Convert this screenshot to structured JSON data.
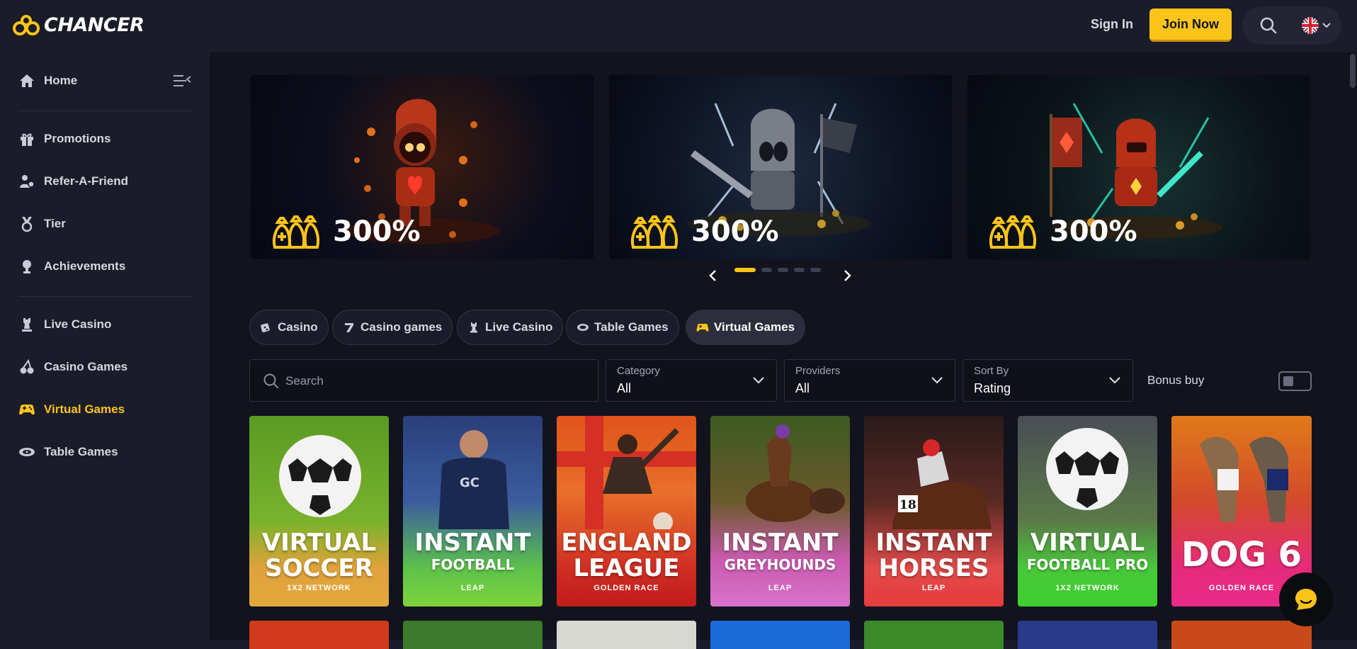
{
  "brand": {
    "name": "CHANCER",
    "accent": "#fcc419"
  },
  "header": {
    "sign_in": "Sign In",
    "join_now": "Join Now"
  },
  "sidebar": {
    "home": "Home",
    "items": [
      {
        "label": "Promotions",
        "icon": "gift-icon"
      },
      {
        "label": "Refer-A-Friend",
        "icon": "refer-friend-icon"
      },
      {
        "label": "Tier",
        "icon": "medal-icon"
      },
      {
        "label": "Achievements",
        "icon": "trophy-icon"
      }
    ],
    "categories": [
      {
        "label": "Live Casino",
        "icon": "chess-piece-icon"
      },
      {
        "label": "Casino Games",
        "icon": "cherries-icon"
      },
      {
        "label": "Virtual Games",
        "icon": "gamepad-icon",
        "active": true
      },
      {
        "label": "Table Games",
        "icon": "chips-icon"
      }
    ]
  },
  "banners": [
    {
      "text": "300%",
      "theme": "fire-knight"
    },
    {
      "text": "300%",
      "theme": "dark-knight"
    },
    {
      "text": "300%",
      "theme": "red-knight"
    }
  ],
  "carousel": {
    "slides": 5,
    "active": 1
  },
  "tabs": [
    {
      "label": "Casino"
    },
    {
      "label": "Casino games"
    },
    {
      "label": "Live Casino"
    },
    {
      "label": "Table Games"
    },
    {
      "label": "Virtual Games",
      "active": true
    }
  ],
  "filters": {
    "search_placeholder": "Search",
    "category": {
      "label": "Category",
      "value": "All"
    },
    "providers": {
      "label": "Providers",
      "value": "All"
    },
    "sort": {
      "label": "Sort By",
      "value": "Rating"
    },
    "bonus_buy": "Bonus buy"
  },
  "games": [
    {
      "line1": "VIRTUAL",
      "line2": "SOCCER",
      "provider": "1X2 NETWORK"
    },
    {
      "line1": "INSTANT",
      "line2": "FOOTBALL",
      "provider": "LEAP"
    },
    {
      "line1": "ENGLAND",
      "line2": "LEAGUE",
      "provider": "GOLDEN RACE"
    },
    {
      "line1": "INSTANT",
      "line2": "GREYHOUNDS",
      "provider": "LEAP"
    },
    {
      "line1": "INSTANT",
      "line2": "HORSES",
      "provider": "LEAP"
    },
    {
      "line1": "VIRTUAL",
      "line2": "FOOTBALL PRO",
      "provider": "1X2 NETWORK"
    },
    {
      "line1": "DOG 6",
      "line2": "",
      "provider": "GOLDEN RACE"
    }
  ]
}
